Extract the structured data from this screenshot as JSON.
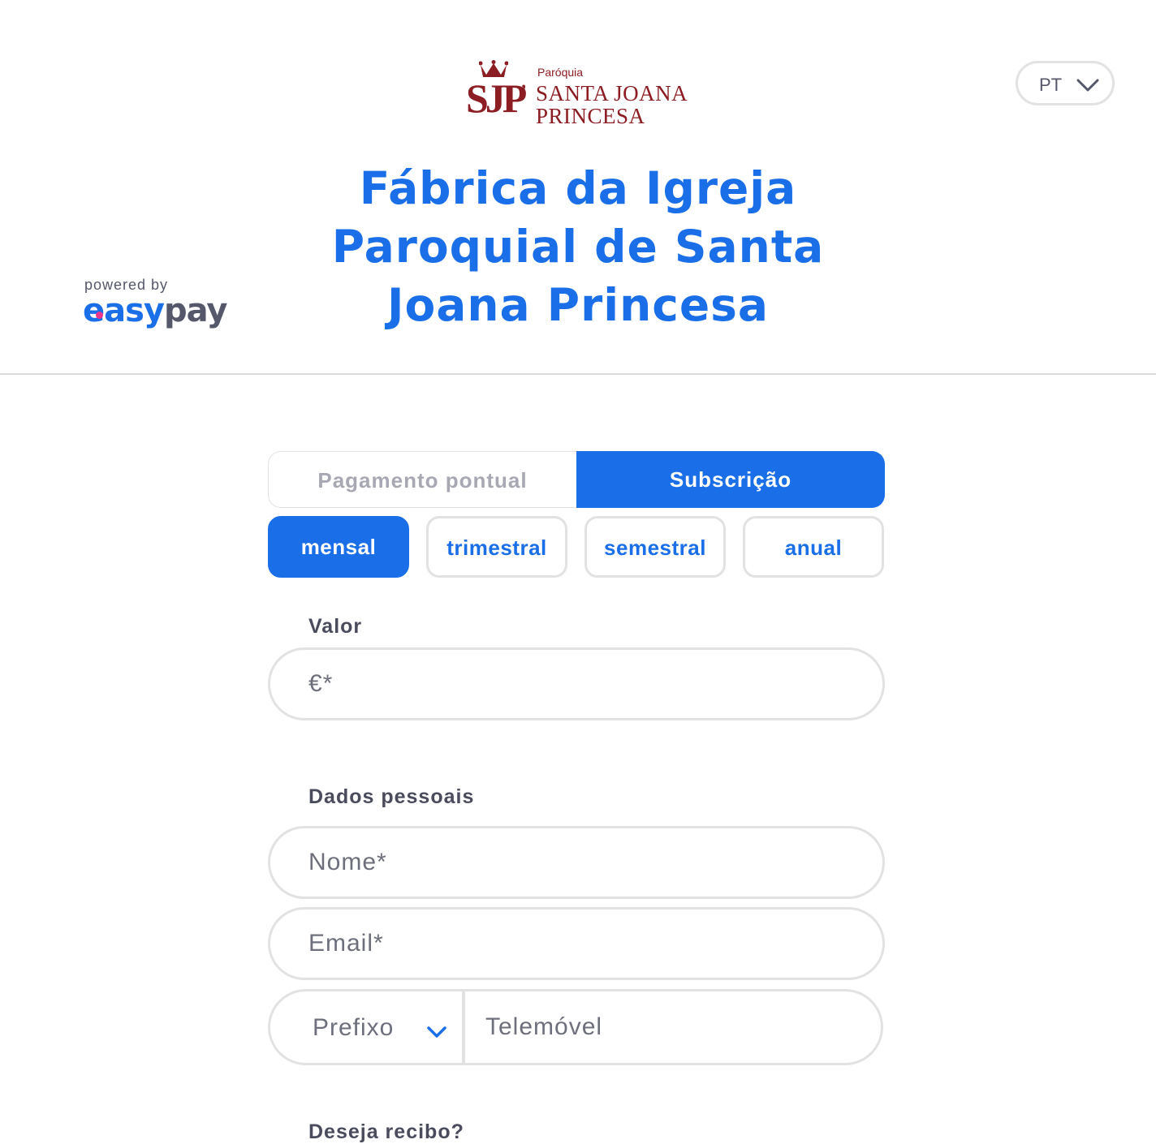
{
  "header": {
    "logo": {
      "small": "Paróquia",
      "line1": "SANTA JOANA",
      "line2": "PRINCESA",
      "monogram": "SJP"
    },
    "language": {
      "value": "PT",
      "icon": "chevron-down-icon"
    },
    "powered_by": {
      "label": "powered by",
      "brand_easy": "easy",
      "brand_pay": "pay"
    },
    "title": "Fábrica da Igreja Paroquial de Santa Joana Princesa"
  },
  "payment_type": {
    "tabs": [
      {
        "label": "Pagamento pontual",
        "active": false
      },
      {
        "label": "Subscrição",
        "active": true
      }
    ]
  },
  "frequency": {
    "options": [
      {
        "label": "mensal",
        "selected": true
      },
      {
        "label": "trimestral",
        "selected": false
      },
      {
        "label": "semestral",
        "selected": false
      },
      {
        "label": "anual",
        "selected": false
      }
    ]
  },
  "amount": {
    "label": "Valor",
    "placeholder": "€*"
  },
  "personal": {
    "label": "Dados pessoais",
    "name_placeholder": "Nome*",
    "email_placeholder": "Email*",
    "prefix_label": "Prefixo",
    "phone_placeholder": "Telemóvel"
  },
  "receipt": {
    "label": "Deseja recibo?"
  },
  "colors": {
    "accent": "#1a6fe8",
    "brand_red": "#8c1d22",
    "border": "#e2e2e2",
    "text_dark": "#4a4c5e",
    "easypay_dot": "#e8358e"
  }
}
